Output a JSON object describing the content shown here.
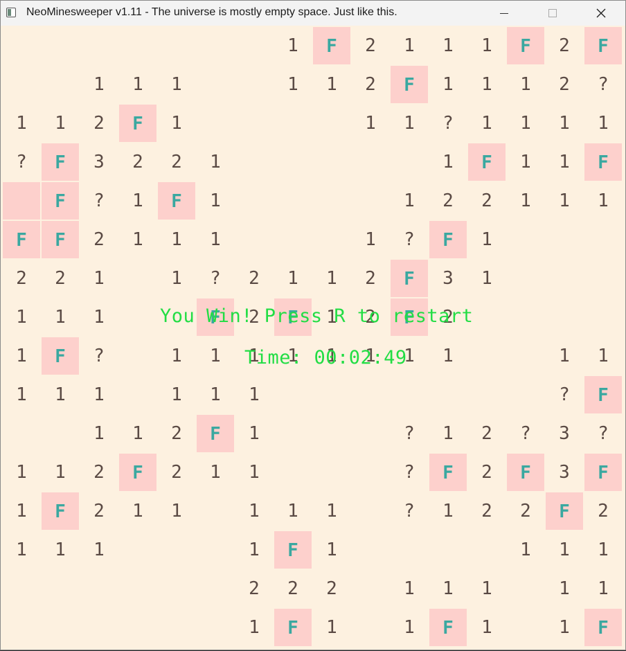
{
  "window": {
    "title": "NeoMinesweeper v1.11 - The universe is mostly empty space. Just like this.",
    "controls": [
      "minimize",
      "maximize",
      "close"
    ]
  },
  "board": {
    "rows": [
      [
        "",
        "",
        "",
        "",
        "",
        "",
        "",
        "1",
        "F",
        "2",
        "1",
        "1",
        "1",
        "F",
        "2",
        "F"
      ],
      [
        "",
        "",
        "1",
        "1",
        "1",
        "",
        "",
        "1",
        "1",
        "2",
        "F",
        "1",
        "1",
        "1",
        "2",
        "?"
      ],
      [
        "1",
        "1",
        "2",
        "F",
        "1",
        "",
        "",
        "",
        "",
        "1",
        "1",
        "?",
        "1",
        "1",
        "1",
        "1"
      ],
      [
        "?",
        "F",
        "3",
        "2",
        "2",
        "1",
        "",
        "",
        "",
        "",
        "",
        "1",
        "F",
        "1",
        "1",
        "F"
      ],
      [
        "#",
        "F",
        "?",
        "1",
        "F",
        "1",
        "",
        "",
        "",
        "",
        "1",
        "2",
        "2",
        "1",
        "1",
        "1"
      ],
      [
        "F",
        "F",
        "2",
        "1",
        "1",
        "1",
        "",
        "",
        "",
        "1",
        "?",
        "F",
        "1",
        "",
        "",
        ""
      ],
      [
        "2",
        "2",
        "1",
        "",
        "1",
        "?",
        "2",
        "1",
        "1",
        "2",
        "F",
        "3",
        "1",
        "",
        "",
        ""
      ],
      [
        "1",
        "1",
        "1",
        "",
        "",
        "F",
        "2",
        "F",
        "1",
        "2",
        "F",
        "2",
        "",
        "",
        "",
        ""
      ],
      [
        "1",
        "F",
        "?",
        "",
        "1",
        "1",
        "1",
        "1",
        "1",
        "1",
        "1",
        "1",
        "",
        "",
        "1",
        "1"
      ],
      [
        "1",
        "1",
        "1",
        "",
        "1",
        "1",
        "1",
        "",
        "",
        "",
        "",
        "",
        "",
        "",
        "?",
        "F"
      ],
      [
        "",
        "",
        "1",
        "1",
        "2",
        "F",
        "1",
        "",
        "",
        "",
        "?",
        "1",
        "2",
        "?",
        "3",
        "?"
      ],
      [
        "1",
        "1",
        "2",
        "F",
        "2",
        "1",
        "1",
        "",
        "",
        "",
        "?",
        "F",
        "2",
        "F",
        "3",
        "F"
      ],
      [
        "1",
        "F",
        "2",
        "1",
        "1",
        "",
        "1",
        "1",
        "1",
        "",
        "?",
        "1",
        "2",
        "2",
        "F",
        "2"
      ],
      [
        "1",
        "1",
        "1",
        "",
        "",
        "",
        "1",
        "F",
        "1",
        "",
        "",
        "",
        "",
        "1",
        "1",
        "1"
      ],
      [
        "",
        "",
        "",
        "",
        "",
        "",
        "2",
        "2",
        "2",
        "",
        "1",
        "1",
        "1",
        "",
        "1",
        "1"
      ],
      [
        "",
        "",
        "",
        "",
        "",
        "",
        "1",
        "F",
        "1",
        "",
        "1",
        "F",
        "1",
        "",
        "1",
        "F"
      ]
    ]
  },
  "overlay": {
    "win_message": "You Win! Press R to restart",
    "time_message": "Time: 00:02:49"
  },
  "colors": {
    "background": "#fdf1e0",
    "tile_highlight": "#fdd0cc",
    "flag": "#3aa8a0",
    "number": "#5a4a44",
    "overlay_text": "#22dd44"
  }
}
